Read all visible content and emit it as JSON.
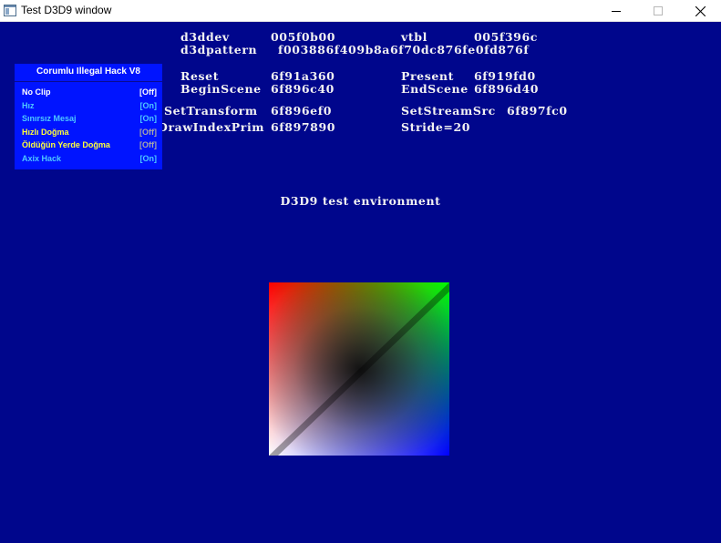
{
  "window": {
    "title": "Test D3D9 window"
  },
  "debug": {
    "d3ddev_label": "d3ddev",
    "d3ddev_value": "005f0b00",
    "vtbl_label": "vtbl",
    "vtbl_value": "005f396c",
    "d3dpattern_label": "d3dpattern",
    "d3dpattern_value": "f003886f409b8a6f70dc876fe0fd876f",
    "reset_label": "Reset",
    "reset_value": "6f91a360",
    "present_label": "Present",
    "present_value": "6f919fd0",
    "beginscene_label": "BeginScene",
    "beginscene_value": "6f896c40",
    "endscene_label": "EndScene",
    "endscene_value": "6f896d40",
    "settransform_label": "SetTransform",
    "settransform_value": "6f896ef0",
    "setstreamsrc_label": "SetStreamSrc",
    "setstreamsrc_value": "6f897fc0",
    "drawindexprim_label": "DrawIndexPrim",
    "drawindexprim_value": "6f897890",
    "stride_text": "Stride=20"
  },
  "hack_menu": {
    "title": "Corumlu Illegal Hack V8",
    "items": [
      {
        "label": "No Clip",
        "state": "[Off]",
        "label_color": "#ffffff",
        "state_color": "#ffffff"
      },
      {
        "label": "Hız",
        "state": "[On]",
        "label_color": "#4ec8ff",
        "state_color": "#4ec8ff"
      },
      {
        "label": "Sınırsız Mesaj",
        "state": "[On]",
        "label_color": "#4ec8ff",
        "state_color": "#4ec8ff"
      },
      {
        "label": "Hızlı Doğma",
        "state": "[Off]",
        "label_color": "#ffff3a",
        "state_color": "#a8a8a8"
      },
      {
        "label": "Öldüğün Yerde Doğma",
        "state": "[Off]",
        "label_color": "#ffff3a",
        "state_color": "#a8a8a8"
      },
      {
        "label": "Axix Hack",
        "state": "[On]",
        "label_color": "#4ec8ff",
        "state_color": "#4ec8ff"
      }
    ]
  },
  "scene": {
    "label": "D3D9 test environment"
  },
  "colors": {
    "background": "#00068c",
    "menu_bg": "#0014ff",
    "debug_text": "#f2f2f2"
  }
}
